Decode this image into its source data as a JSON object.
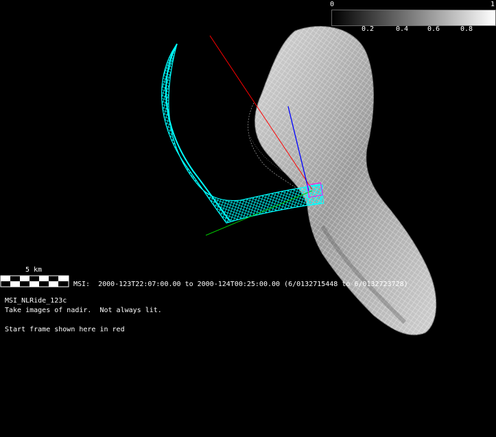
{
  "colorbar": {
    "min_label": "0",
    "max_label": "1",
    "ticks": [
      "0.2",
      "0.4",
      "0.6",
      "0.8"
    ],
    "gradient_from": "#000000",
    "gradient_to": "#ffffff"
  },
  "scale_bar": {
    "label": "5 km"
  },
  "msi_line": "MSI:  2000-123T22:07:00.00 to 2000-124T00:25:00.00 (6/0132715448 to 6/0132723728)",
  "observation": {
    "name": "MSI_NLRide_123c",
    "description": "Take images of nadir.  Not always lit.",
    "note": "Start frame shown here in red"
  },
  "colors": {
    "footprint": "#00ffff",
    "start_frame": "#ff0000",
    "axis_blue": "#0000ff",
    "axis_green": "#00cc00",
    "asteroid": "#bfbfbf"
  }
}
